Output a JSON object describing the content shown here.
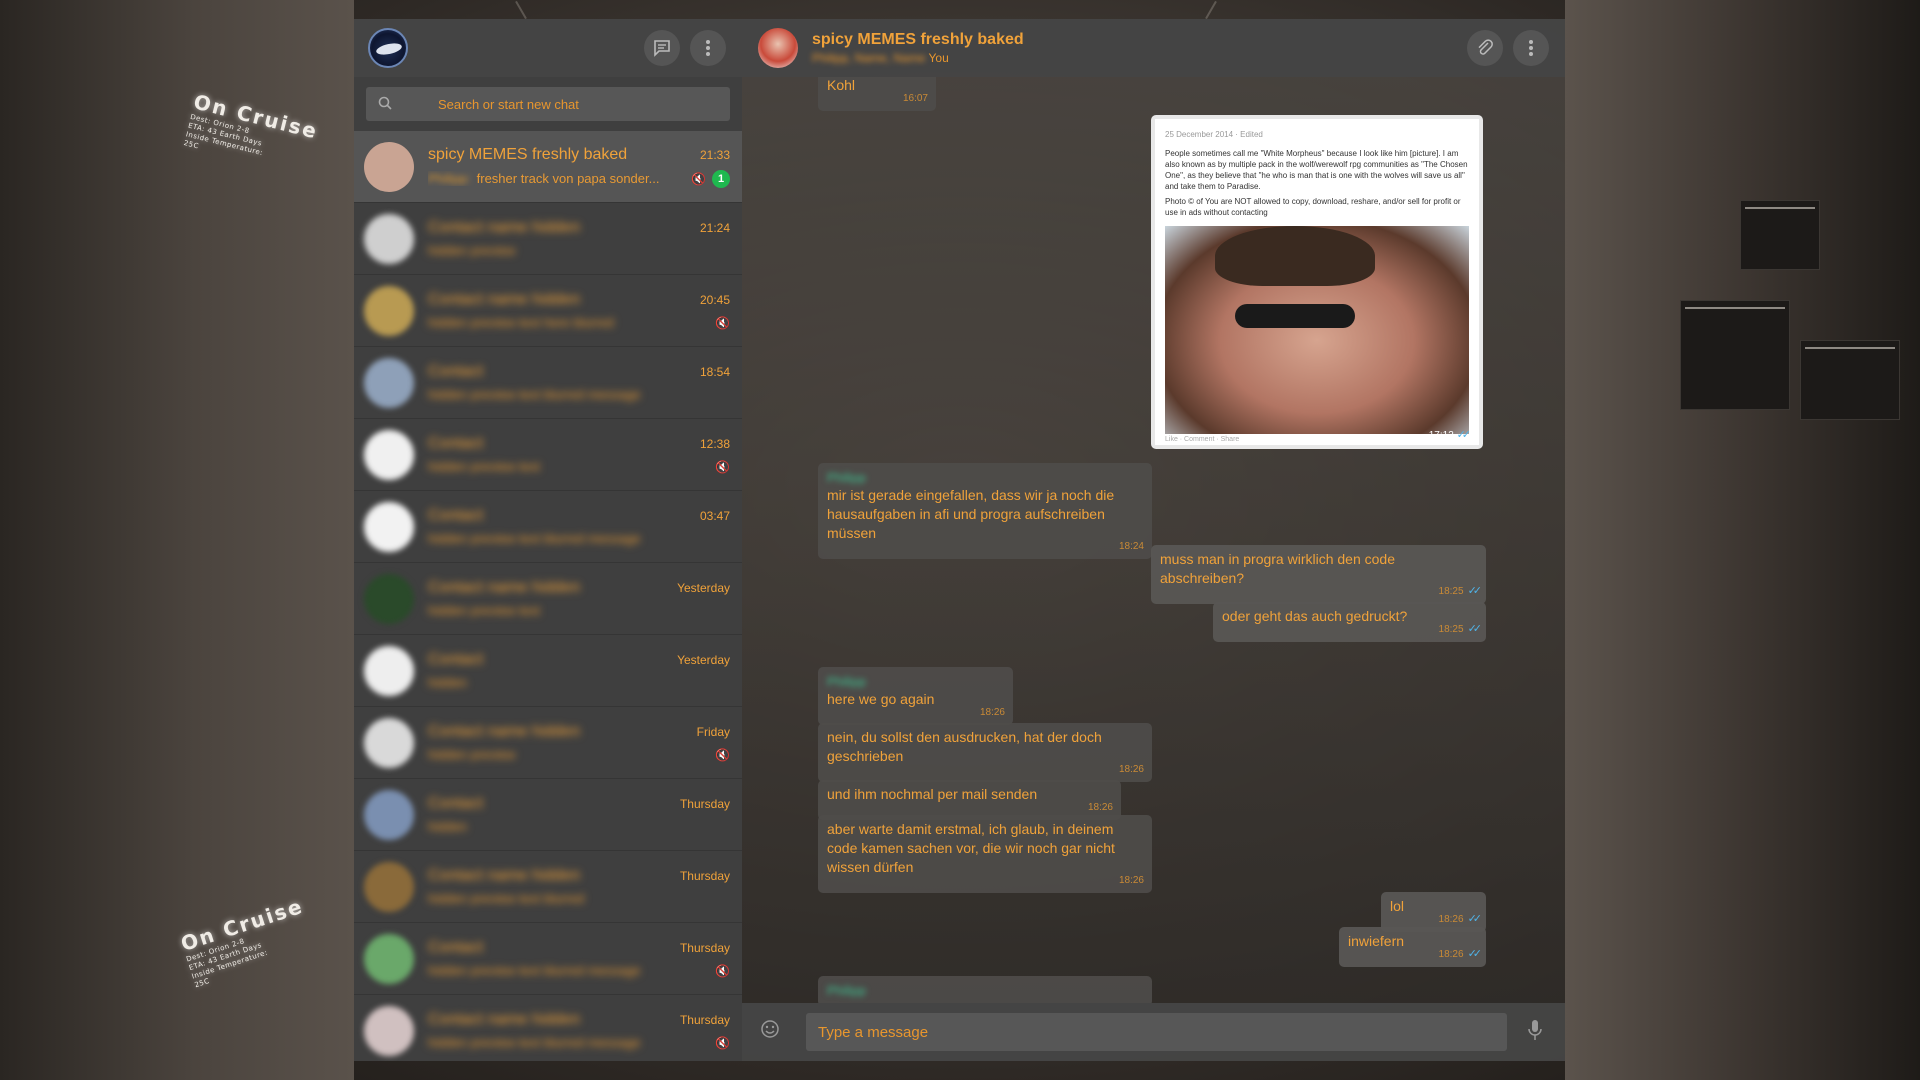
{
  "background": {
    "sign_top": {
      "title": "On Cruise",
      "lines": [
        "Dest: Orion 2-8",
        "ETA: 43 Earth Days",
        "Inside Temperature:",
        "25C"
      ]
    },
    "sign_bottom": {
      "title": "On Cruise",
      "lines": [
        "Dest: Orion 2-8",
        "ETA: 43 Earth Days",
        "Inside Temperature:",
        "25C"
      ]
    }
  },
  "sidebar": {
    "search_placeholder": "Search or start new chat",
    "chats": [
      {
        "name": "spicy MEMES freshly baked",
        "time": "21:33",
        "preview_sender": "Philipp:",
        "preview": "fresher track von papa sonder...",
        "unread": "1",
        "muted": true,
        "active": true,
        "blurred": false
      },
      {
        "name": "Contact name hidden",
        "time": "21:24",
        "preview": "hidden preview",
        "muted": false,
        "blurred": true
      },
      {
        "name": "Contact name hidden",
        "time": "20:45",
        "preview": "hidden preview text here blurred",
        "muted": true,
        "blurred": true
      },
      {
        "name": "Contact",
        "time": "18:54",
        "preview": "hidden preview text blurred message",
        "muted": false,
        "blurred": true
      },
      {
        "name": "Contact",
        "time": "12:38",
        "preview": "hidden preview text",
        "muted": true,
        "blurred": true
      },
      {
        "name": "Contact",
        "time": "03:47",
        "preview": "hidden preview text blurred message",
        "muted": false,
        "blurred": true
      },
      {
        "name": "Contact name hidden",
        "time": "Yesterday",
        "preview": "hidden preview text",
        "muted": false,
        "blurred": true
      },
      {
        "name": "Contact",
        "time": "Yesterday",
        "preview": "hidden",
        "muted": false,
        "blurred": true
      },
      {
        "name": "Contact name hidden",
        "time": "Friday",
        "preview": "hidden preview",
        "muted": true,
        "blurred": true
      },
      {
        "name": "Contact",
        "time": "Thursday",
        "preview": "hidden",
        "muted": false,
        "blurred": true
      },
      {
        "name": "Contact name hidden",
        "time": "Thursday",
        "preview": "hidden preview text blurred",
        "muted": false,
        "blurred": true
      },
      {
        "name": "Contact",
        "time": "Thursday",
        "preview": "hidden preview text blurred message",
        "muted": true,
        "blurred": true
      },
      {
        "name": "Contact name hidden",
        "time": "Thursday",
        "preview": "hidden preview text blurred message",
        "muted": true,
        "blurred": true
      }
    ]
  },
  "conversation": {
    "name": "spicy MEMES freshly baked",
    "members_hidden": "Philipp, Name, Name",
    "members_you": "You",
    "image_post": {
      "header": "25 December 2014 · Edited",
      "text": "People sometimes call me \"White Morpheus\" because I look like him [picture]. I am also known as by multiple pack in the wolf/werewolf rpg communities as \"The Chosen One\", as they believe that \"he who is man that is one with the wolves will save us all\" and take them to Paradise.",
      "copyright": "Photo © of                              You are NOT allowed to copy, download, reshare, and/or sell for profit or use in ads without contacting",
      "footer": "Like · Comment · Share",
      "time": "17:12"
    },
    "messages": [
      {
        "dir": "in",
        "text": "Kohl",
        "time": "16:07"
      },
      {
        "dir": "in",
        "sender": "Philipp",
        "text": "mir ist gerade eingefallen, dass wir ja noch die hausaufgaben in afi und progra aufschreiben müssen",
        "time": "18:24"
      },
      {
        "dir": "out",
        "text": "muss man in progra wirklich den code abschreiben?",
        "time": "18:25"
      },
      {
        "dir": "out",
        "text": "oder geht das auch gedruckt?",
        "time": "18:25"
      },
      {
        "dir": "in",
        "sender": "Philipp",
        "text": "here we go again",
        "time": "18:26"
      },
      {
        "dir": "in",
        "text": "nein, du sollst den ausdrucken, hat der doch geschrieben",
        "time": "18:26"
      },
      {
        "dir": "in",
        "text": "und ihm nochmal per mail senden",
        "time": "18:26"
      },
      {
        "dir": "in",
        "text": "aber warte damit erstmal, ich glaub, in deinem code kamen sachen vor, die wir noch gar nicht wissen dürfen",
        "time": "18:26"
      },
      {
        "dir": "out",
        "text": "lol",
        "time": "18:26"
      },
      {
        "dir": "out",
        "text": "inwiefern",
        "time": "18:26"
      },
      {
        "dir": "in",
        "sender": "Philipp",
        "text": "",
        "time": ""
      }
    ],
    "composer_placeholder": "Type a message"
  },
  "colors": {
    "accent": "#f0a23a",
    "unread": "#1fb84f",
    "tick": "#4fb3e8",
    "sender": "#3fbf8f"
  }
}
